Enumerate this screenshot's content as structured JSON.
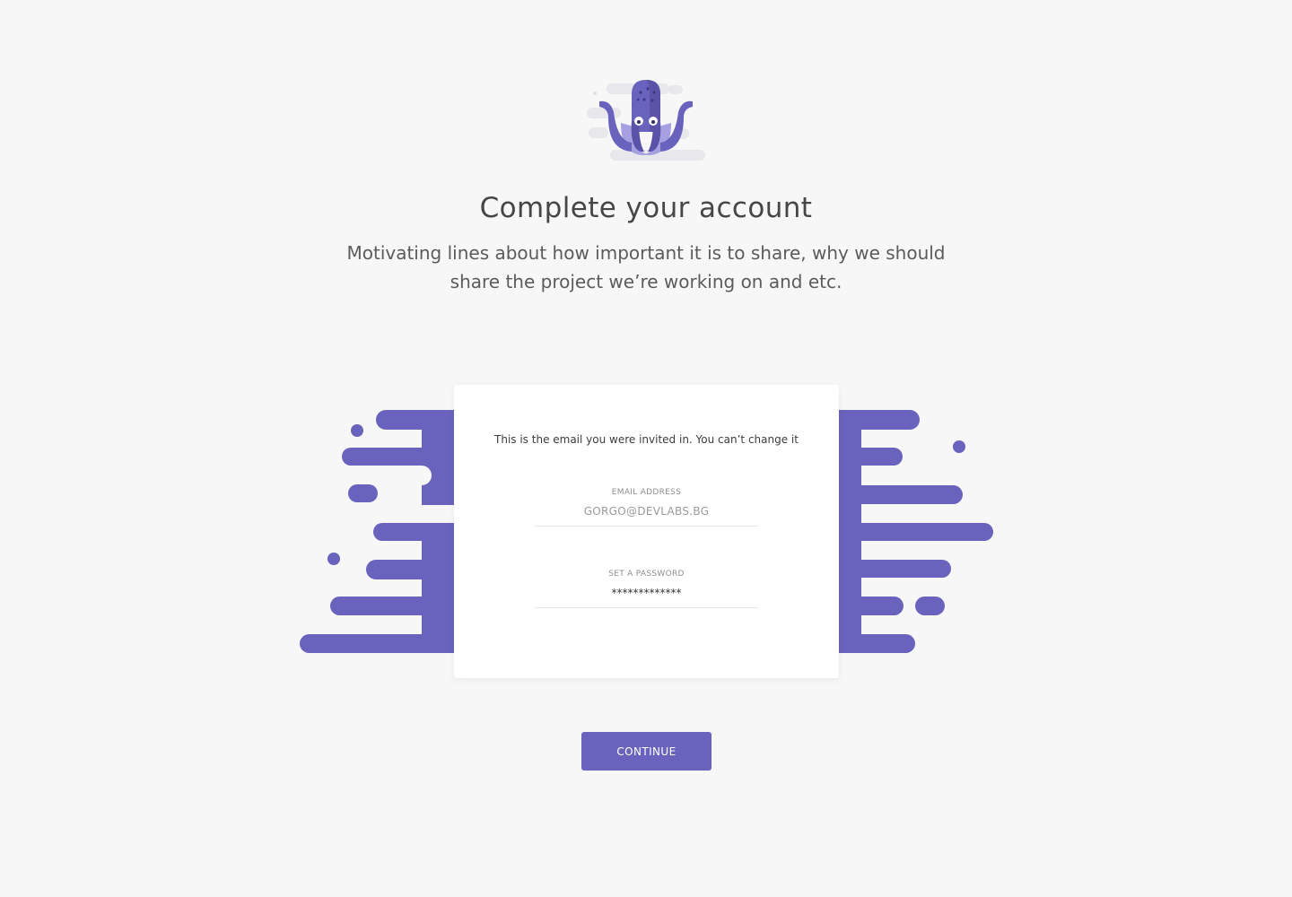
{
  "header": {
    "title": "Complete your account",
    "subtitle": "Motivating lines about how important it is to share, why we should share the project we’re working on and etc."
  },
  "form": {
    "note": "This is the email you were invited in. You can’t change it",
    "email_label": "EMAIL ADDRESS",
    "email_value": "GORGO@DEVLABS.BG",
    "password_label": "SET A PASSWORD",
    "password_value": "*************"
  },
  "actions": {
    "continue_label": "CONTINUE"
  },
  "colors": {
    "accent": "#6a63bd",
    "background": "#f7f7f7",
    "card": "#ffffff"
  },
  "icons": {
    "logo": "octopus-mascot-icon"
  }
}
